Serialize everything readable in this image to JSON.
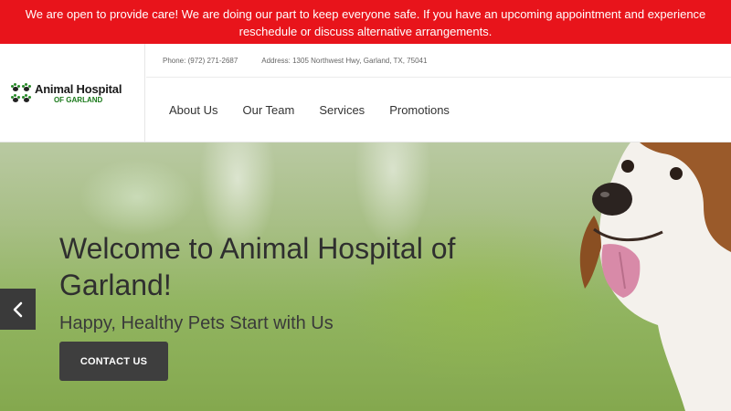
{
  "alert": {
    "line1": "We are open to provide care! We are doing our part to keep everyone safe. If you have an upcoming appointment and experience",
    "line2": "reschedule or discuss alternative arrangements."
  },
  "logo": {
    "name": "Animal Hospital",
    "sub": "OF GARLAND"
  },
  "contact": {
    "phone": "Phone: (972) 271-2687",
    "address": "Address: 1305 Northwest Hwy, Garland, TX, 75041"
  },
  "nav": {
    "items": [
      "About Us",
      "Our Team",
      "Services",
      "Promotions"
    ]
  },
  "hero": {
    "title": "Welcome to Animal Hospital of Garland!",
    "subtitle": "Happy, Healthy Pets Start with Us",
    "cta": "CONTACT US"
  },
  "colors": {
    "alert_bg": "#e8141b",
    "button_bg": "#3e3e3e",
    "logo_green": "#1b7a1b"
  },
  "icons": {
    "logo": "paw-print-icon",
    "carousel_prev": "chevron-left-icon"
  }
}
